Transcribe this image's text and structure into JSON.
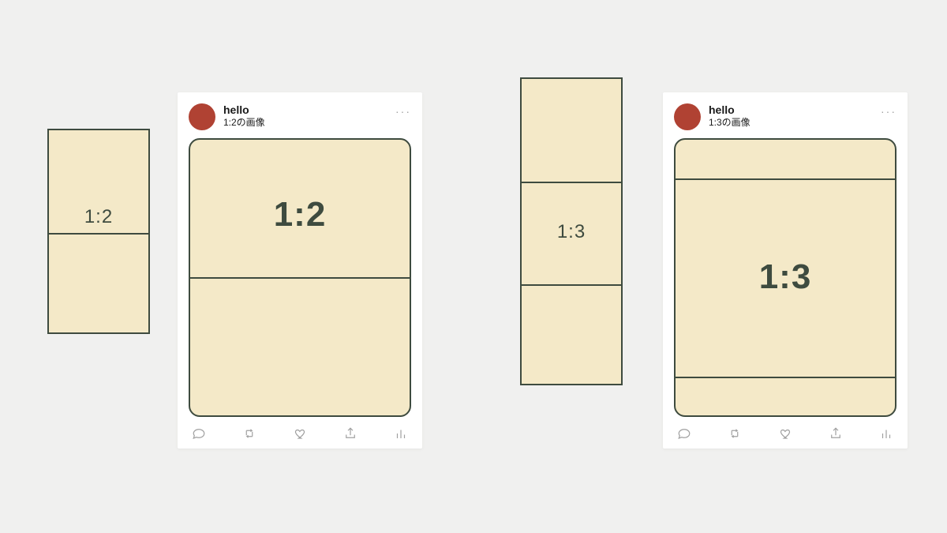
{
  "colors": {
    "panel": "#f4e9c8",
    "panel_border": "#3e4b3f",
    "avatar": "#b04233",
    "background": "#f0f0ef"
  },
  "examples": [
    {
      "ratio_label": "1:2",
      "username": "hello",
      "caption": "1:2の画像"
    },
    {
      "ratio_label": "1:3",
      "username": "hello",
      "caption": "1:3の画像"
    }
  ],
  "icons": {
    "more": "···"
  }
}
